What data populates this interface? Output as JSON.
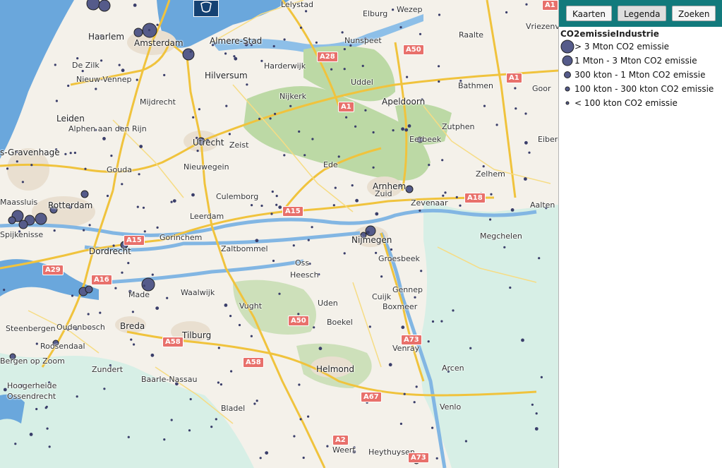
{
  "toolbar": {
    "buttons": [
      {
        "label": "Kaarten",
        "active": false
      },
      {
        "label": "Legenda",
        "active": true
      },
      {
        "label": "Zoeken",
        "active": false
      }
    ]
  },
  "legend": {
    "title": "CO2emissieIndustrie",
    "items": [
      {
        "label": "> 3 Mton CO2 emissie"
      },
      {
        "label": "1 Mton - 3 Mton CO2 emissie"
      },
      {
        "label": "300 kton - 1 Mton CO2 emissie"
      },
      {
        "label": "100 kton - 300 kton CO2 emissie"
      },
      {
        "label": "< 100 kton CO2 emissie"
      }
    ]
  },
  "colors": {
    "toolbar": "#127a7c",
    "emission_marker": "#555b8a",
    "water": "#5b9bd5",
    "sea_south": "#d7efe6",
    "highway": "#f0c33d",
    "forest": "#bcd9a5",
    "highway_shield": "#e8706b"
  },
  "map": {
    "cities": [
      "Lelystad",
      "Elburg",
      "Wezep",
      "Raalte",
      "Vriezenve",
      "Haarlem",
      "Amsterdam",
      "Almere-Stad",
      "Nunspeet",
      "De Zilk",
      "Nieuw-Vennep",
      "Harderwijk",
      "Uddel",
      "Bathmen",
      "Goor",
      "Hilversum",
      "Mijdrecht",
      "Nijkerk",
      "Apeldoorn",
      "Leiden",
      "Alphen aan den Rijn",
      "Zutphen",
      "Eibergen",
      "Eerbeek",
      "s-Gravenhage",
      "Utrecht",
      "Zeist",
      "Nieuwegein",
      "Gouda",
      "Ede",
      "Zelhem",
      "Culemborg",
      "Arnhem",
      "Zuid",
      "Zevenaar",
      "Aalten",
      "Rotterdam",
      "Leerdam",
      "Gorinchem",
      "Zaltbommel",
      "Megchelen",
      "Maassluis",
      "Spijkenisse",
      "Dordrecht",
      "Nijmegen",
      "Groesbeek",
      "Oss",
      "Heesch",
      "Cuijk",
      "Gennep",
      "Made",
      "Waalwijk",
      "Vught",
      "Uden",
      "Boxmeer",
      "Steenbergen",
      "Oudenbosch",
      "Breda",
      "Tilburg",
      "Boekel",
      "Venray",
      "Roosendaal",
      "Bergen op Zoom",
      "Zundert",
      "Helmond",
      "Arcen",
      "Baarle-Nassau",
      "Hoogerheide",
      "Ossendrecht",
      "Bladel",
      "Venlo",
      "Weert",
      "Heythuysen"
    ],
    "highways": [
      "A28",
      "A50",
      "A1",
      "A1",
      "A1",
      "A15",
      "A15",
      "A18",
      "A29",
      "A16",
      "A50",
      "A58",
      "A58",
      "A73",
      "A67",
      "A2",
      "A73"
    ]
  }
}
